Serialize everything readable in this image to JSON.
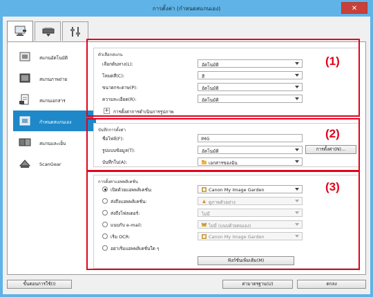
{
  "window": {
    "title": "การตั้งค่า (กำหนดสแกนเอง)",
    "close_glyph": "✕"
  },
  "tabs": [
    {
      "icon": "scan-from-computer-icon"
    },
    {
      "icon": "scan-from-operation-panel-icon"
    },
    {
      "icon": "general-settings-icon"
    }
  ],
  "sidebar": {
    "items": [
      {
        "label": "สแกนอัตโนมัติ",
        "icon": "auto-scan-icon"
      },
      {
        "label": "สแกนภาพถ่าย",
        "icon": "photo-scan-icon"
      },
      {
        "label": "สแกนเอกสาร",
        "icon": "document-scan-icon"
      },
      {
        "label": "กำหนดสแกนเอง",
        "icon": "custom-scan-icon",
        "selected": true
      },
      {
        "label": "สแกนและเย็บ",
        "icon": "scan-and-stitch-icon"
      },
      {
        "label": "ScanGear",
        "icon": "scangear-icon"
      }
    ]
  },
  "scan_options": {
    "title": "ตัวเลือกสแกน",
    "rows": [
      {
        "label": "เลือกต้นทาง(L):",
        "value": "อัตโนมัติ"
      },
      {
        "label": "โหมดสี(C):",
        "value": "สี"
      },
      {
        "label": "ขนาดกระดาษ(P):",
        "value": "อัตโนมัติ"
      },
      {
        "label": "ความละเอียด(R):",
        "value": "อัตโนมัติ"
      }
    ],
    "expander_glyph": "+",
    "image_processing_label": "การตั้งค่าการดำเนินการรูปภาพ",
    "callout": "(1)"
  },
  "save_settings": {
    "title": "บันทึกการตั้งค่า",
    "file_name_label": "ชื่อไฟล์(F):",
    "file_name_value": "IMG",
    "data_format_label": "รูปแบบข้อมูล(T):",
    "data_format_value": "อัตโนมัติ",
    "settings_button": "การตั้งค่า(N)...",
    "save_in_label": "บันทึกใน(A):",
    "save_in_value": "เอกสารของฉัน",
    "callout": "(2)"
  },
  "app_settings": {
    "title": "การตั้งค่าแอพพลิเคชั่น",
    "rows": [
      {
        "label": "เปิดด้วยแอพพลิเคชั่น:",
        "value": "Canon My Image Garden",
        "selected": true,
        "enabled": true,
        "icon": "canon-app-icon"
      },
      {
        "label": "ส่งถึงแอพพลิเคชั่น:",
        "value": "ดูภาพตัวอย่าง",
        "selected": false,
        "enabled": false,
        "icon": "preview-app-icon"
      },
      {
        "label": "ส่งถึงโฟลเดอร์:",
        "value": "ไม่มี",
        "selected": false,
        "enabled": false,
        "icon": ""
      },
      {
        "label": "แนบกับ e-mail:",
        "value": "ไม่มี (แนบด้วยตนเอง)",
        "selected": false,
        "enabled": false,
        "icon": "mail-app-icon"
      },
      {
        "label": "เริ่ม OCR:",
        "value": "Canon My Image Garden",
        "selected": false,
        "enabled": false,
        "icon": "canon-app-icon"
      },
      {
        "label": "อย่าเริ่มแอพพลิเคชั่นใด ๆ",
        "value": "",
        "selected": false,
        "enabled": false,
        "icon": ""
      }
    ],
    "more_functions_button": "ฟังก์ชั่นเพิ่มเติม(M)",
    "callout": "(3)"
  },
  "footer": {
    "instructions_button": "ขั้นตอนการใช้(I)",
    "defaults_button": "ค่ามาตรฐาน(U)",
    "ok_button": "ตกลง"
  },
  "colors": {
    "titlebar": "#5fb3e6",
    "selected_item": "#1e88c8",
    "callout_red": "#e3001b"
  }
}
